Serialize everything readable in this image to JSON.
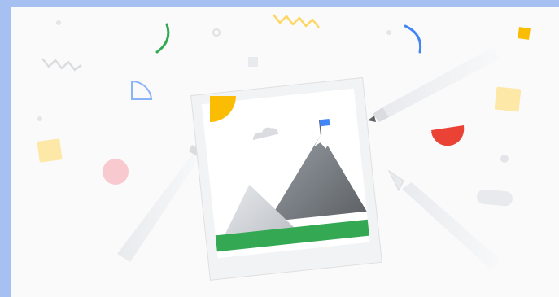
{
  "illustration": {
    "subject": "photo-with-mountains-and-pens-confetti",
    "colors": {
      "frame_border": "#a7c0f2",
      "background": "#fafafa",
      "photo_card": "#f1f3f4",
      "sun": "#fbbc04",
      "grass": "#34a853",
      "flag": "#4285f4",
      "red_accent": "#ea4335",
      "green_accent": "#34a853",
      "blue_accent": "#4285f4",
      "pale_yellow": "#fde8a8",
      "pink": "#f8c9cf",
      "grey_shapes": "#e3e5e8"
    }
  }
}
